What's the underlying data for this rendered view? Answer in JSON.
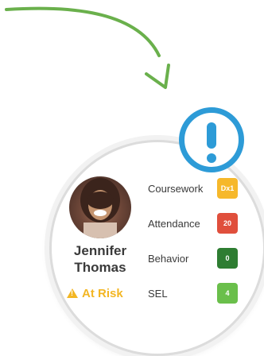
{
  "student": {
    "first_name": "Jennifer",
    "last_name": "Thomas",
    "status": "At Risk",
    "status_icon": "warning-icon"
  },
  "alert": {
    "icon": "exclamation-icon"
  },
  "metrics": [
    {
      "label": "Coursework",
      "value": "Dx1",
      "color": "#f6b82b"
    },
    {
      "label": "Attendance",
      "value": "20",
      "color": "#e04f3c"
    },
    {
      "label": "Behavior",
      "value": "0",
      "color": "#2e7d32"
    },
    {
      "label": "SEL",
      "value": "4",
      "color": "#6abf4b"
    }
  ],
  "colors": {
    "accent": "#2d9bd7",
    "risk": "#f3b623",
    "arrow": "#6ab04c"
  }
}
